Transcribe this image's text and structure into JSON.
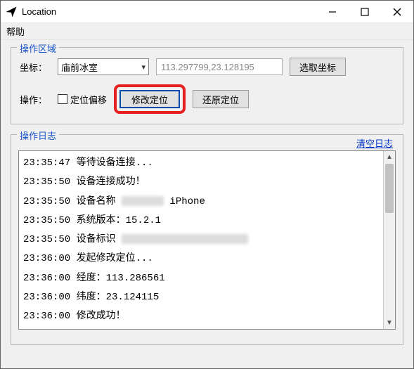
{
  "window": {
    "title": "Location"
  },
  "menu": {
    "help": "帮助"
  },
  "area": {
    "legend": "操作区域",
    "coord_label": "坐标：",
    "location_name": "庙前冰室",
    "coord_value": "113.297799,23.128195",
    "pick_coord_btn": "选取坐标",
    "op_label": "操作：",
    "offset_checkbox": "定位偏移",
    "modify_btn": "修改定位",
    "restore_btn": "还原定位"
  },
  "log": {
    "legend": "操作日志",
    "clear_link": "清空日志",
    "lines": [
      {
        "time": "23:35:47",
        "text": "等待设备连接..."
      },
      {
        "time": "23:35:50",
        "text": "设备连接成功！"
      },
      {
        "time": "23:35:50",
        "text": "设备名称",
        "redacted_after": true,
        "tail": " iPhone"
      },
      {
        "time": "23:35:50",
        "text": "系统版本：15.2.1"
      },
      {
        "time": "23:35:50",
        "text": "设备标识",
        "redacted_after": true,
        "redacted_wide": true
      },
      {
        "time": "23:36:00",
        "text": "发起修改定位..."
      },
      {
        "time": "23:36:00",
        "text": "经度：113.286561"
      },
      {
        "time": "23:36:00",
        "text": "纬度：23.124115"
      },
      {
        "time": "23:36:00",
        "text": "修改成功！",
        "cut": true
      }
    ]
  }
}
